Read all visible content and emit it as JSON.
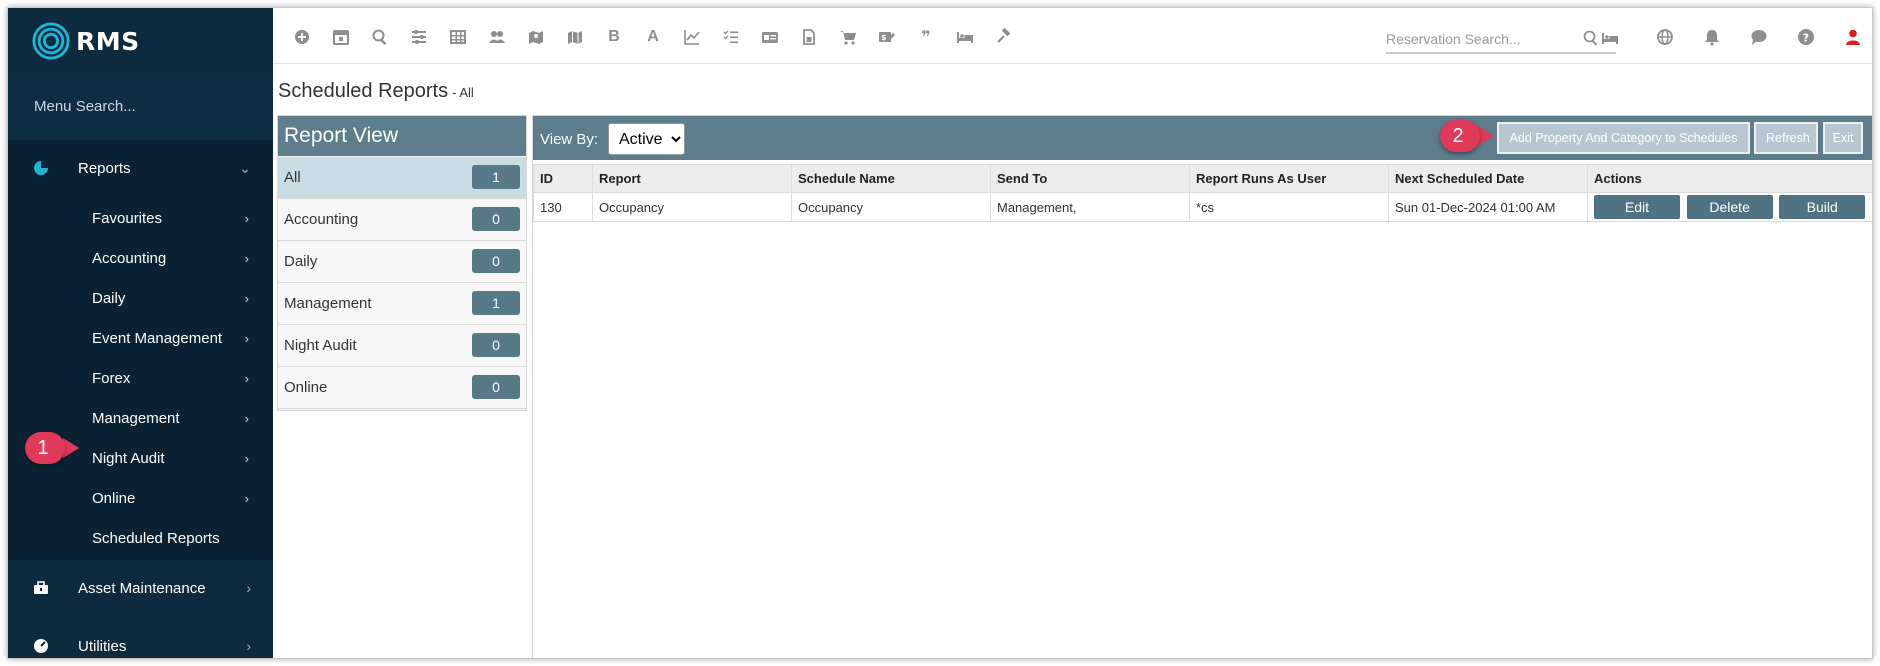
{
  "brand": {
    "name": "RMS"
  },
  "sidebar": {
    "menu_search_placeholder": "Menu Search...",
    "reports_label": "Reports",
    "sub_items": [
      {
        "label": "Favourites"
      },
      {
        "label": "Accounting"
      },
      {
        "label": "Daily"
      },
      {
        "label": "Event Management"
      },
      {
        "label": "Forex"
      },
      {
        "label": "Management"
      },
      {
        "label": "Night Audit"
      },
      {
        "label": "Online"
      },
      {
        "label": "Scheduled Reports"
      }
    ],
    "asset_maintenance_label": "Asset Maintenance",
    "utilities_label": "Utilities"
  },
  "callouts": {
    "one": "1",
    "two": "2"
  },
  "topbar": {
    "icons": [
      "plus-circle-icon",
      "calendar-icon",
      "search-icon",
      "sliders-icon",
      "grid-icon",
      "users-icon",
      "map-pin-icon",
      "map-icon",
      "bold-b-icon",
      "letter-a-icon",
      "line-chart-icon",
      "checklist-icon",
      "id-card-icon",
      "document-icon",
      "cart-icon",
      "dollar-tag-icon",
      "quote-icon",
      "bed-icon",
      "gavel-icon"
    ],
    "reservation_search_placeholder": "Reservation Search...",
    "right_icons": [
      "globe-icon",
      "bell-icon",
      "chat-icon",
      "help-icon",
      "user-icon"
    ],
    "user_icon_color": "#e01b1b"
  },
  "page": {
    "title": "Scheduled Reports",
    "title_suffix": "- All"
  },
  "report_view": {
    "header": "Report View",
    "items": [
      {
        "label": "All",
        "count": "1"
      },
      {
        "label": "Accounting",
        "count": "0"
      },
      {
        "label": "Daily",
        "count": "0"
      },
      {
        "label": "Management",
        "count": "1"
      },
      {
        "label": "Night Audit",
        "count": "0"
      },
      {
        "label": "Online",
        "count": "0"
      }
    ]
  },
  "toolbar": {
    "view_by_label": "View By:",
    "view_by_value": "Active",
    "add_property_label": "Add Property And Category to Schedules",
    "refresh_label": "Refresh",
    "exit_label": "Exit"
  },
  "table": {
    "headers": [
      "ID",
      "Report",
      "Schedule Name",
      "Send To",
      "Report Runs As User",
      "Next Scheduled Date",
      "Actions"
    ],
    "rows": [
      {
        "id": "130",
        "report": "Occupancy",
        "schedule_name": "Occupancy",
        "send_to": "Management,",
        "runs_as": "*cs",
        "next_date": "Sun 01-Dec-2024 01:00 AM"
      }
    ],
    "actions": {
      "edit": "Edit",
      "delete": "Delete",
      "build": "Build"
    }
  },
  "colors": {
    "sidebar_bg": "#0d2a3e",
    "header_bg": "#5d7d8d",
    "callout": "#e03a5a",
    "action_btn": "#4f7383",
    "brand_accent": "#1bb7d6"
  }
}
